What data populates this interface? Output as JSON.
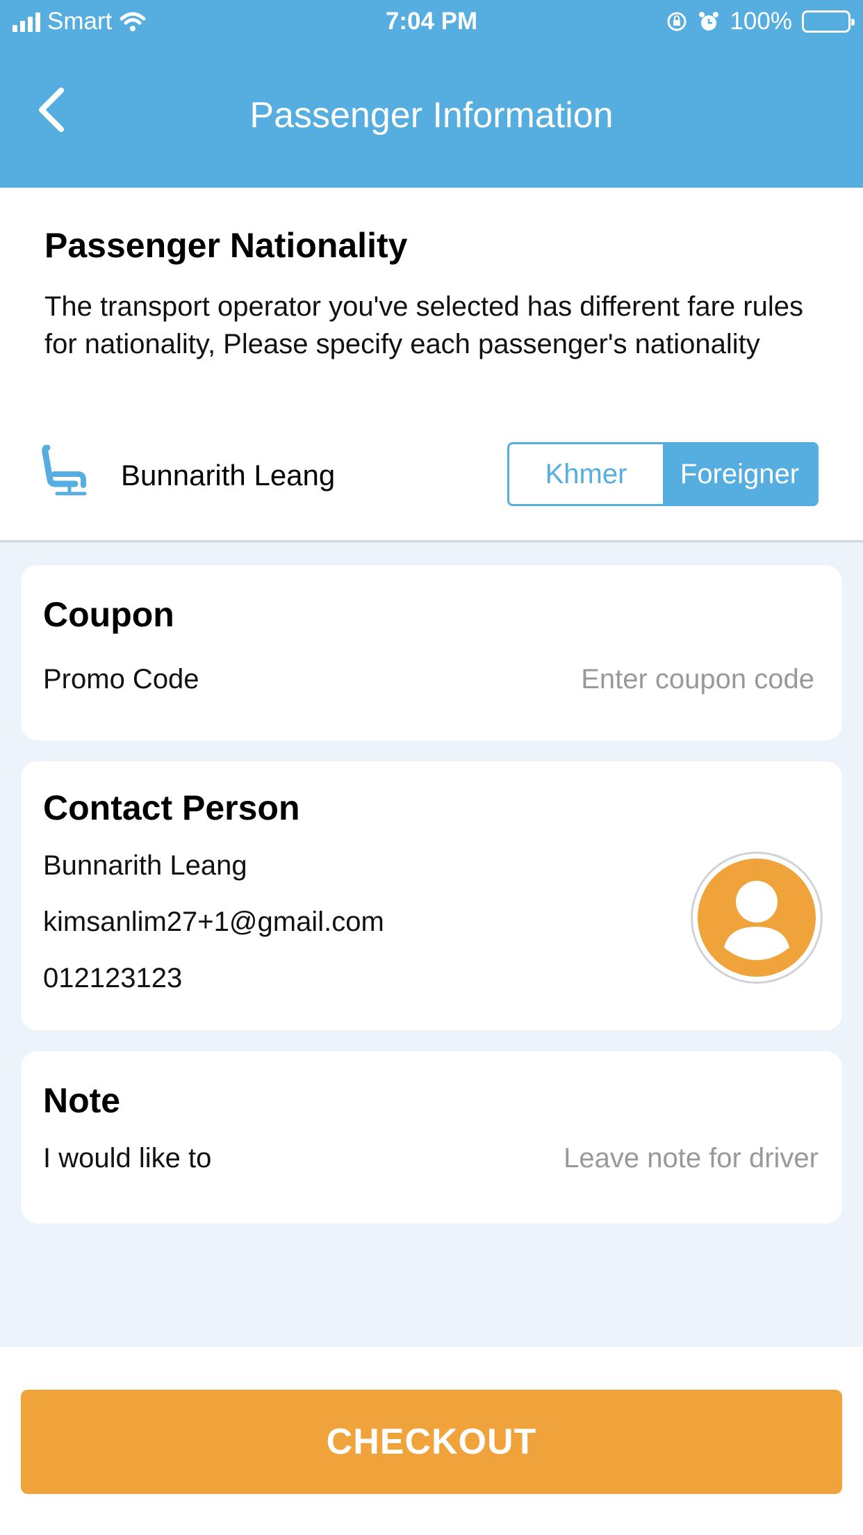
{
  "status_bar": {
    "carrier": "Smart",
    "time": "7:04 PM",
    "battery": "100%"
  },
  "header": {
    "title": "Passenger Information",
    "back_icon": "chevron-left-icon"
  },
  "nationality": {
    "title": "Passenger Nationality",
    "description": "The transport operator you've selected has different fare rules for nationality, Please specify each passenger's nationality",
    "passenger_name": "Bunnarith Leang",
    "seat_icon": "seat-icon",
    "options": [
      "Khmer",
      "Foreigner"
    ],
    "selected": "Foreigner"
  },
  "coupon": {
    "title": "Coupon",
    "label": "Promo Code",
    "placeholder": "Enter coupon code"
  },
  "contact": {
    "title": "Contact Person",
    "name": "Bunnarith Leang",
    "email": "kimsanlim27+1@gmail.com",
    "phone": "012123123",
    "avatar_icon": "user-icon"
  },
  "note": {
    "title": "Note",
    "label": "I would like to",
    "placeholder": "Leave note for driver"
  },
  "footer": {
    "checkout_label": "CHECKOUT"
  },
  "colors": {
    "primary": "#55ade0",
    "accent": "#f0a23b",
    "background": "#edf3fb"
  }
}
